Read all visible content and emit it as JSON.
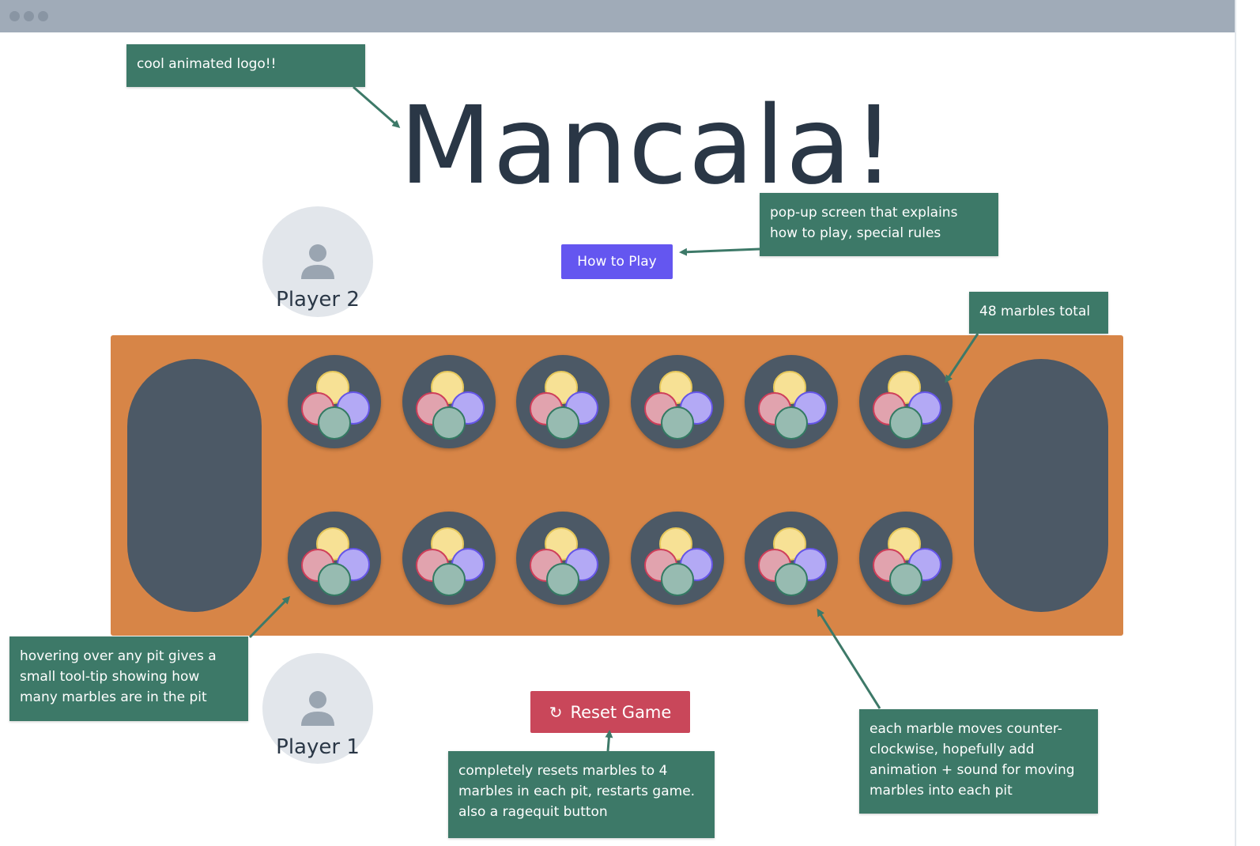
{
  "logo": {
    "title": "Mancala!"
  },
  "players": {
    "top": {
      "label": "Player 2",
      "icon": "user-icon"
    },
    "bottom": {
      "label": "Player 1",
      "icon": "user-icon"
    }
  },
  "buttons": {
    "how_to_play": "How to Play",
    "reset": {
      "label": "Reset Game",
      "icon": "refresh-icon"
    }
  },
  "notes": {
    "logo": "cool animated logo!!",
    "how_to_play": "pop-up screen that explains how to play,  special rules",
    "marbles_total": "48 marbles total",
    "hover": "hovering over any pit gives a small tool-tip showing how many marbles are in the pit",
    "reset": "completely resets marbles to 4 marbles in each pit, restarts game. also a ragequit button",
    "movement": "each marble moves counter-clockwise, hopefully add animation  + sound for moving marbles into each pit"
  },
  "board": {
    "pits_per_row": 6,
    "marbles_per_pit": 4,
    "marble_colors": [
      "#f7e195",
      "#e1a3ae",
      "#b3a9f5",
      "#97bbb1"
    ]
  },
  "colors": {
    "board": "#d78547",
    "pit": "#4c5966",
    "note": "#3d7968",
    "how_to_play_button": "#6456f0",
    "reset_button": "#c9475a"
  }
}
